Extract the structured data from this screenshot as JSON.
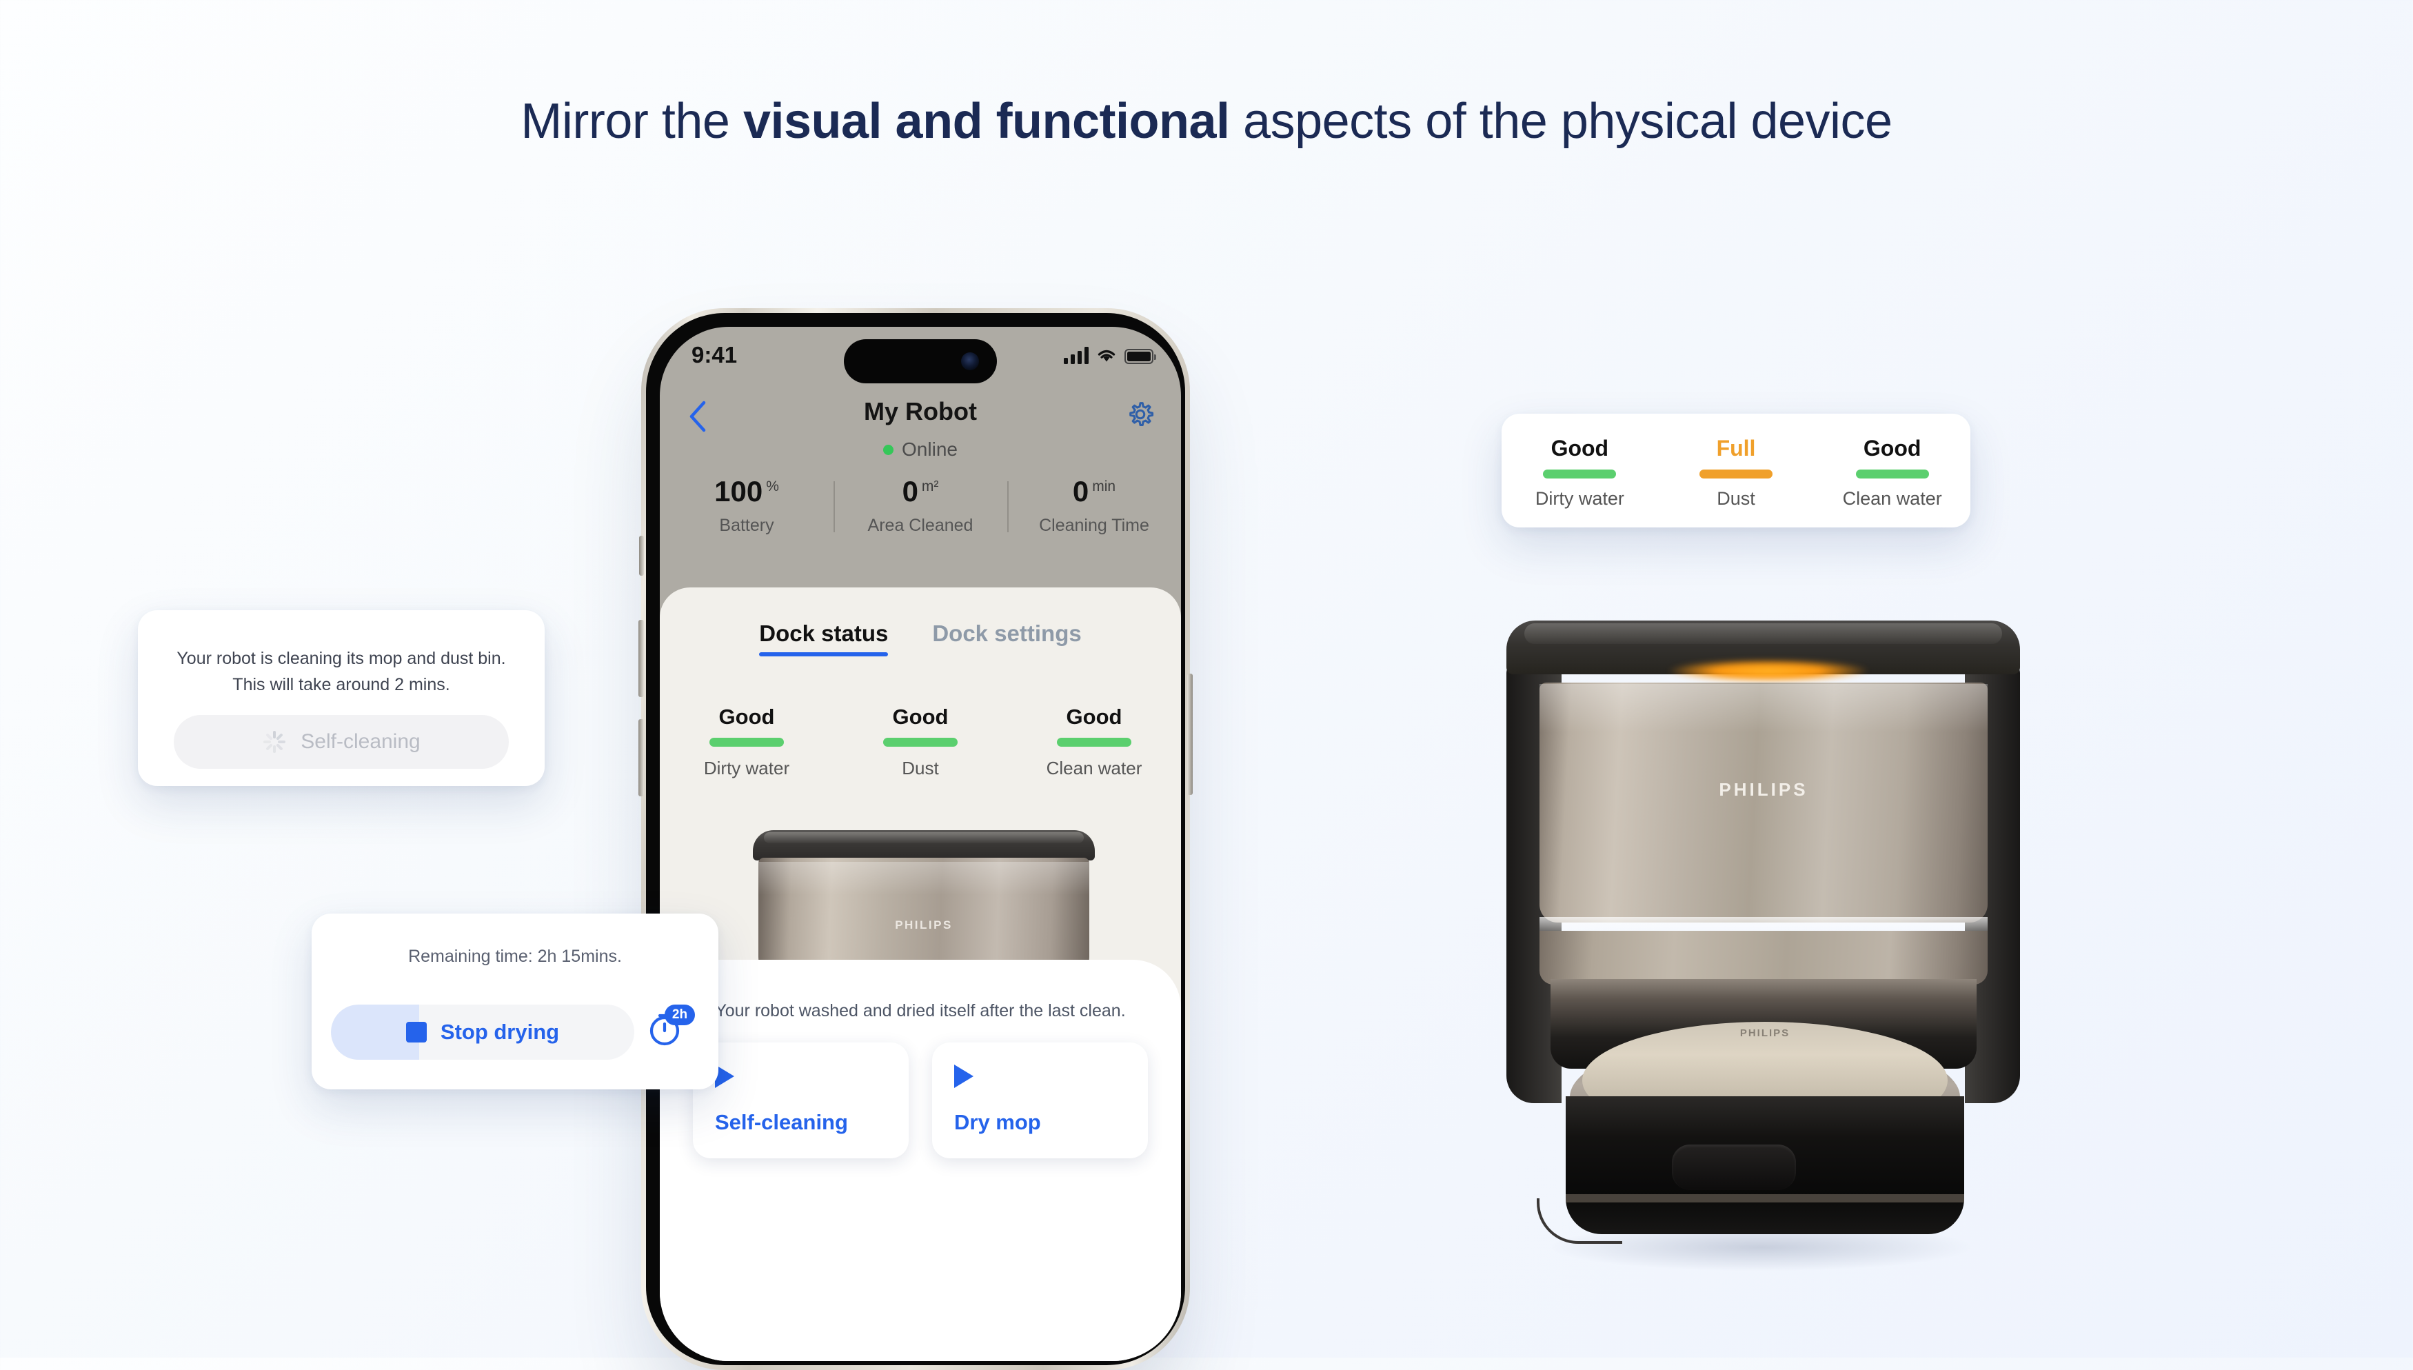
{
  "headline": {
    "part1": "Mirror the ",
    "bold": "visual and functional",
    "part2": " aspects of the physical device"
  },
  "colors": {
    "accent_blue": "#2563eb",
    "status_good": "#5bcf6e",
    "status_full": "#f0a02b",
    "headline": "#1b2a54",
    "background": "#f5f8fd"
  },
  "phone": {
    "statusbar": {
      "time": "9:41",
      "signal_icon": "signal-bars-icon",
      "wifi_icon": "wifi-icon",
      "battery_icon": "battery-icon"
    },
    "nav": {
      "back_icon": "chevron-left-icon",
      "title": "My Robot",
      "settings_icon": "gear-icon"
    },
    "connection": {
      "status": "Online",
      "dot_icon": "status-dot-icon"
    },
    "stats": [
      {
        "value": "100",
        "unit": "%",
        "label": "Battery"
      },
      {
        "value": "0",
        "unit": "m²",
        "label": "Area Cleaned"
      },
      {
        "value": "0",
        "unit": "min",
        "label": "Cleaning Time"
      }
    ],
    "tabs": [
      {
        "label": "Dock status",
        "active": true
      },
      {
        "label": "Dock settings",
        "active": false
      }
    ],
    "dock_status": [
      {
        "value": "Good",
        "label": "Dirty water",
        "state": "good"
      },
      {
        "value": "Good",
        "label": "Dust",
        "state": "good"
      },
      {
        "value": "Good",
        "label": "Clean water",
        "state": "good"
      }
    ],
    "dock_image": {
      "brand": "PHILIPS"
    },
    "note": "Your robot washed and dried itself after the last clean.",
    "actions": [
      {
        "label": "Self-cleaning",
        "icon": "play-icon"
      },
      {
        "label": "Dry mop",
        "icon": "play-icon"
      }
    ]
  },
  "card_selfcleaning": {
    "line1": "Your robot is cleaning its mop and dust bin.",
    "line2": "This will take around 2 mins.",
    "button_label": "Self-cleaning",
    "spinner_icon": "loading-spinner-icon"
  },
  "card_drying": {
    "remaining": "Remaining time: 2h 15mins.",
    "button_label": "Stop drying",
    "stop_icon": "stop-square-icon",
    "timer_icon": "timer-icon",
    "timer_badge": "2h"
  },
  "card_status": [
    {
      "value": "Good",
      "label": "Dirty water",
      "state": "good"
    },
    {
      "value": "Full",
      "label": "Dust",
      "state": "full"
    },
    {
      "value": "Good",
      "label": "Clean water",
      "state": "good"
    }
  ],
  "product": {
    "brand": "PHILIPS",
    "robot_brand": "PHILIPS"
  }
}
